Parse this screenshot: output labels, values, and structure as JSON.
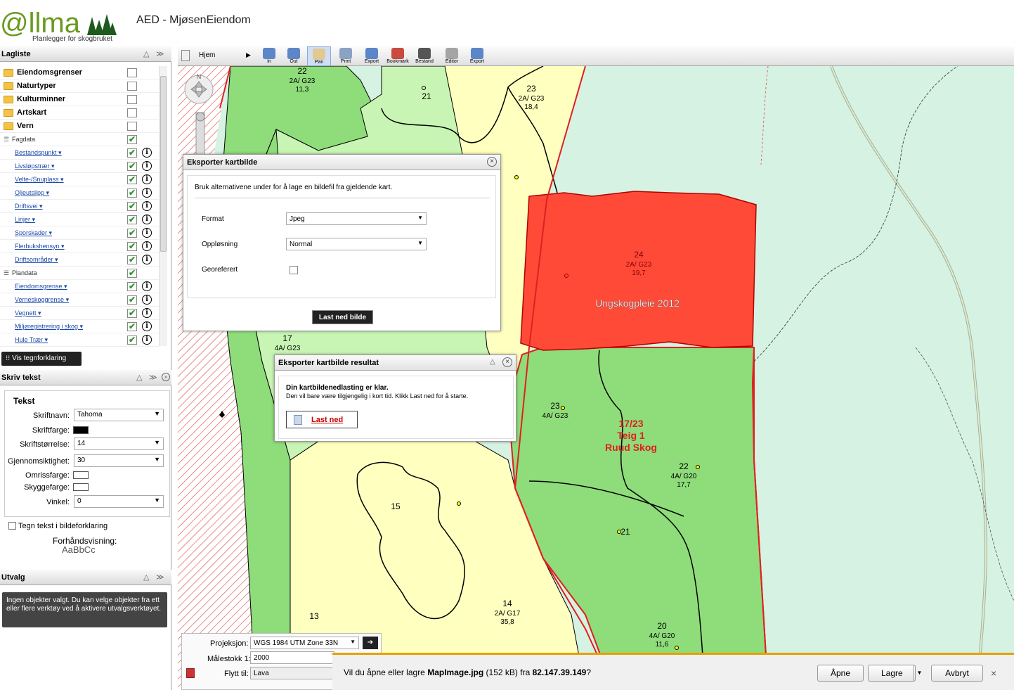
{
  "header": {
    "logo_text": "@llma",
    "logo_tagline": "Planlegger for skogbruket",
    "title": "AED - MjøsenEiendom"
  },
  "layer_panel": {
    "title": "Lagliste",
    "groups": [
      {
        "label": "Eiendomsgrenser",
        "checked": false
      },
      {
        "label": "Naturtyper",
        "checked": false
      },
      {
        "label": "Kulturminner",
        "checked": false
      },
      {
        "label": "Artskart",
        "checked": false
      },
      {
        "label": "Vern",
        "checked": false
      }
    ],
    "fagdata_label": "Fagdata",
    "fagdata_items": [
      "Bestandspunkt",
      "Livsløpstrær",
      "Velte-/Snuplass",
      "Oljeutslipp",
      "Driftsvei",
      "Linjer",
      "Sporskader",
      "Flerbukshensyn",
      "Driftsområder"
    ],
    "plandata_label": "Plandata",
    "plandata_items": [
      "Eiendomsgrense",
      "Verneskoggrense",
      "Vegnett",
      "Miljøregistrering i skog",
      "Hule Trær"
    ],
    "legend_button": "Vis tegnforklaring"
  },
  "text_panel": {
    "title": "Skriv tekst",
    "section": "Tekst",
    "font_name_label": "Skriftnavn:",
    "font_name_value": "Tahoma",
    "font_color_label": "Skriftfarge:",
    "font_size_label": "Skriftstørrelse:",
    "font_size_value": "14",
    "transparency_label": "Gjennomsiktighet:",
    "transparency_value": "30",
    "outline_label": "Omrissfarge:",
    "shadow_label": "Skyggefarge:",
    "angle_label": "Vinkel:",
    "angle_value": "0",
    "legend_checkbox": "Tegn tekst i bildeforklaring",
    "preview_label": "Forhåndsvisning:",
    "preview_sample": "AaBbCc"
  },
  "selection_panel": {
    "title": "Utvalg",
    "message": "Ingen objekter valgt. Du kan velge objekter fra ett eller flere verktøy ved å aktivere utvalgsverktøyet."
  },
  "toolbar": {
    "home_label": "Hjem",
    "tools": [
      {
        "label": "In",
        "icon": "zoom-in-icon"
      },
      {
        "label": "Out",
        "icon": "zoom-out-icon"
      },
      {
        "label": "Pan",
        "icon": "pan-hand-icon"
      },
      {
        "label": "Print",
        "icon": "print-icon"
      },
      {
        "label": "Export",
        "icon": "export-icon"
      },
      {
        "label": "Bookmark",
        "icon": "bookmark-icon"
      },
      {
        "label": "Bestand",
        "icon": "bestand-icon"
      },
      {
        "label": "Editor",
        "icon": "editor-icon"
      },
      {
        "label": "Export",
        "icon": "export-icon"
      }
    ]
  },
  "map": {
    "compass_north": "N",
    "labels": [
      {
        "id": "22",
        "sub": "2A/ G23",
        "val": "11,3"
      },
      {
        "id": "21"
      },
      {
        "id": "23",
        "sub": "2A/ G23",
        "val": "18,4"
      },
      {
        "id": "24",
        "sub": "2A/ G23",
        "val": "19,7"
      },
      {
        "id": "17",
        "sub": "4A/ G23"
      },
      {
        "id": "23",
        "sub": "4A/ G23"
      },
      {
        "id": "22",
        "sub": "4A/ G20",
        "val": "17,7"
      },
      {
        "id": "21"
      },
      {
        "id": "15"
      },
      {
        "id": "14",
        "sub": "2A/ G17",
        "val": "35,8"
      },
      {
        "id": "13"
      },
      {
        "id": "20",
        "sub": "4A/ G20",
        "val": "11,6"
      }
    ],
    "annotation": "Ungskogpleie 2012",
    "property_label": [
      "17/23",
      "Teig 1",
      "Ruud Skog"
    ],
    "colors": {
      "light_green": "#c8f5b4",
      "mid_green": "#8edc7a",
      "yellow": "#ffffc0",
      "red": "#ff4a38",
      "mint": "#d6f2e2",
      "boundary": "#e02020"
    }
  },
  "export_dialog": {
    "title": "Eksporter kartbilde",
    "intro": "Bruk alternativene under for å lage en bildefil fra gjeldende kart.",
    "format_label": "Format",
    "format_value": "Jpeg",
    "resolution_label": "Oppløsning",
    "resolution_value": "Normal",
    "georef_label": "Georeferert",
    "download_button": "Last ned bilde"
  },
  "result_dialog": {
    "title": "Eksporter kartbilde resultat",
    "heading": "Din kartbildenedlasting er klar.",
    "body": "Den vil bare være tilgjengelig i kort tid. Klikk Last ned for å starte.",
    "link": "Last ned"
  },
  "bottom_controls": {
    "projection_label": "Projeksjon:",
    "projection_value": "WGS 1984 UTM Zone 33N",
    "scale_label": "Målestokk 1:",
    "scale_value": "2000",
    "move_label": "Flytt til:",
    "move_value": "Lava"
  },
  "download_bar": {
    "prompt_prefix": "Vil du åpne eller lagre ",
    "file": "MapImage.jpg",
    "size": " (152 kB) fra ",
    "host": "82.147.39.149",
    "suffix": "?",
    "open": "Åpne",
    "save": "Lagre",
    "cancel": "Avbryt"
  }
}
